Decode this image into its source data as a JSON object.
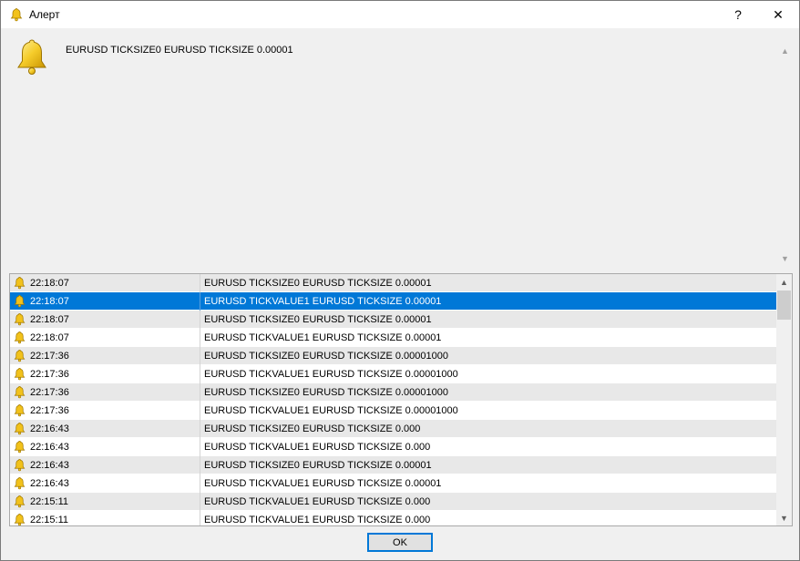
{
  "window": {
    "title": "Алерт",
    "help_label": "?",
    "close_label": "✕"
  },
  "message": {
    "text": "EURUSD TICKSIZE0 EURUSD TICKSIZE 0.00001"
  },
  "alerts": [
    {
      "time": "22:18:07",
      "message": "EURUSD TICKSIZE0 EURUSD TICKSIZE 0.00001"
    },
    {
      "time": "22:18:07",
      "message": "EURUSD TICKVALUE1 EURUSD TICKSIZE 0.00001"
    },
    {
      "time": "22:18:07",
      "message": "EURUSD TICKSIZE0 EURUSD TICKSIZE 0.00001"
    },
    {
      "time": "22:18:07",
      "message": "EURUSD TICKVALUE1 EURUSD TICKSIZE 0.00001"
    },
    {
      "time": "22:17:36",
      "message": "EURUSD TICKSIZE0 EURUSD TICKSIZE 0.00001000"
    },
    {
      "time": "22:17:36",
      "message": "EURUSD TICKVALUE1 EURUSD TICKSIZE 0.00001000"
    },
    {
      "time": "22:17:36",
      "message": "EURUSD TICKSIZE0 EURUSD TICKSIZE 0.00001000"
    },
    {
      "time": "22:17:36",
      "message": "EURUSD TICKVALUE1 EURUSD TICKSIZE 0.00001000"
    },
    {
      "time": "22:16:43",
      "message": "EURUSD TICKSIZE0 EURUSD TICKSIZE 0.000"
    },
    {
      "time": "22:16:43",
      "message": "EURUSD TICKVALUE1 EURUSD TICKSIZE 0.000"
    },
    {
      "time": "22:16:43",
      "message": "EURUSD TICKSIZE0 EURUSD TICKSIZE 0.00001"
    },
    {
      "time": "22:16:43",
      "message": "EURUSD TICKVALUE1 EURUSD TICKSIZE 0.00001"
    },
    {
      "time": "22:15:11",
      "message": "EURUSD TICKVALUE1 EURUSD TICKSIZE 0.000"
    },
    {
      "time": "22:15:11",
      "message": "EURUSD TICKVALUE1 EURUSD TICKSIZE 0.000"
    }
  ],
  "selected_index": 1,
  "buttons": {
    "ok_label": "OK"
  },
  "icons": {
    "alert": "bell-icon"
  },
  "colors": {
    "selection": "#0078d7",
    "bell": "#f2c21b"
  }
}
